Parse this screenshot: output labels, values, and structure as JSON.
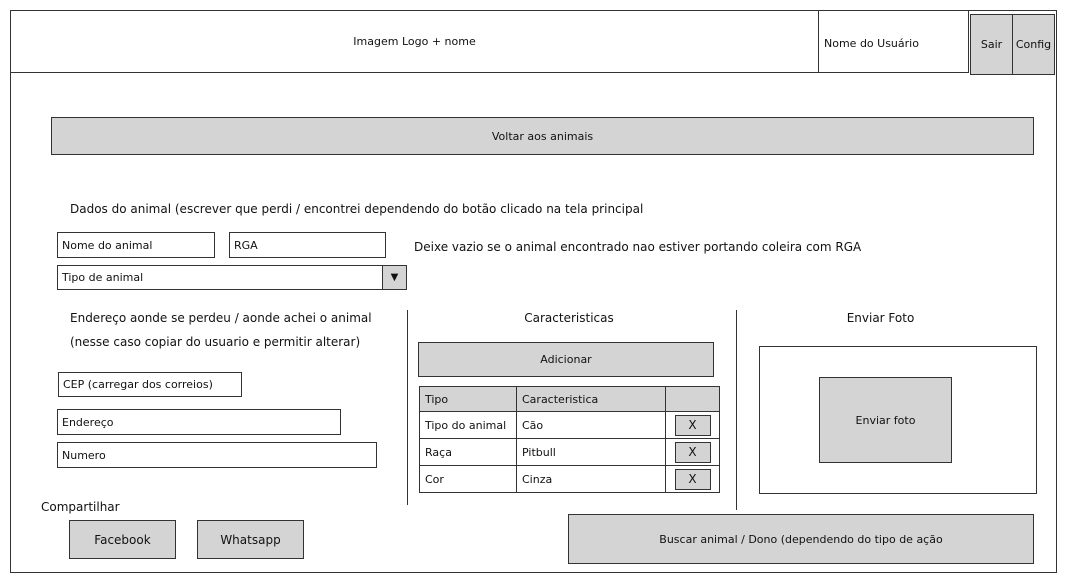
{
  "header": {
    "logo": "Imagem Logo + nome",
    "user_name": "Nome do Usuário",
    "logout": "Sair",
    "config": "Config"
  },
  "back_button": "Voltar aos animais",
  "animal_data": {
    "title": "Dados do animal   (escrever que perdi / encontrei dependendo do botão clicado na tela principal",
    "name_field": "Nome do animal",
    "rga_field": "RGA",
    "rga_hint": "Deixe vazio se o animal encontrado nao estiver portando coleira com RGA",
    "type_select": "Tipo de animal"
  },
  "address": {
    "title": "Endereço aonde se perdeu / aonde achei o animal",
    "note": "(nesse caso copiar do usuario e permitir alterar)",
    "cep_field": "CEP (carregar dos correios)",
    "address_field": "Endereço",
    "number_field": "Numero"
  },
  "characteristics": {
    "title": "Caracteristicas",
    "add_button": "Adicionar",
    "columns": [
      "Tipo",
      "Caracteristica"
    ],
    "rows": [
      {
        "tipo": "Tipo do animal",
        "caracteristica": "Cão",
        "remove": "X"
      },
      {
        "tipo": "Raça",
        "caracteristica": "Pitbull",
        "remove": "X"
      },
      {
        "tipo": "Cor",
        "caracteristica": "Cinza",
        "remove": "X"
      }
    ]
  },
  "photo": {
    "title": "Enviar Foto",
    "button": "Enviar foto"
  },
  "share": {
    "title": "Compartilhar",
    "facebook": "Facebook",
    "whatsapp": "Whatsapp"
  },
  "search_button": "Buscar animal / Dono (dependendo do tipo de ação",
  "colors": {
    "button_fill": "#d4d4d4",
    "border": "#333333"
  }
}
